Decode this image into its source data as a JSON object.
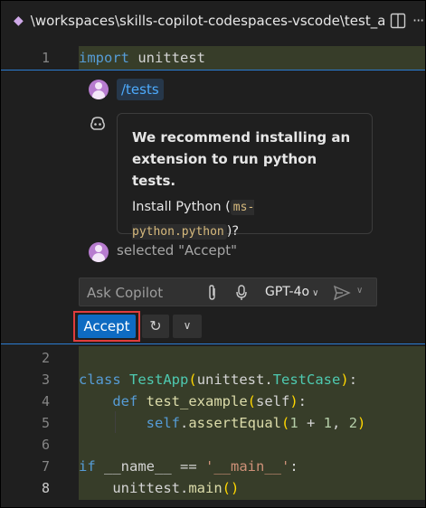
{
  "tab": {
    "file_icon": "file-icon",
    "path": "\\workspaces\\skills-copilot-codespaces-vscode\\test_ap"
  },
  "toolbar": {
    "split_icon": "split-editor-icon",
    "more_icon": "more-actions-icon",
    "more_glyph": "···"
  },
  "code_lines": [
    {
      "num": "1"
    },
    {
      "num": "2"
    },
    {
      "num": "3"
    },
    {
      "num": "4"
    },
    {
      "num": "5"
    },
    {
      "num": "6"
    },
    {
      "num": "7"
    },
    {
      "num": "8"
    }
  ],
  "code": {
    "line1_kw": "import",
    "line1_rest": " unittest",
    "line3_kw": "class",
    "line3_cls": "TestApp",
    "line3_mid": "unittest.",
    "line3_base": "TestCase",
    "line3_end": ":",
    "line4_kw": "def",
    "line4_fn": "test_example",
    "line4_param": "self",
    "line4_end": ":",
    "line5_self": "self",
    "line5_dot": ".",
    "line5_fn": "assertEqual",
    "line5_n1": "1",
    "line5_plus": " + ",
    "line5_n2": "1",
    "line5_comma": ", ",
    "line5_n3": "2",
    "line7_kw": "if",
    "line7_mid": " __name__ == ",
    "line7_str": "'__main__'",
    "line7_end": ":",
    "line8_text": "unittest.",
    "line8_fn": "main"
  },
  "chat": {
    "user_avatar": "user-avatar",
    "slash_command": "/tests",
    "copilot_icon": "copilot-icon",
    "message_title": "We recommend installing an extension to run python tests.",
    "message_body_prefix": "Install Python (",
    "message_code": "ms-python.python",
    "message_body_suffix": ")?",
    "selected_text": "selected \"Accept\""
  },
  "input": {
    "placeholder": "Ask Copilot",
    "attach_icon": "paperclip-icon",
    "mic_icon": "microphone-icon",
    "model": "GPT-4o",
    "send_icon": "send-icon"
  },
  "actions": {
    "accept_label": "Accept",
    "rerun_icon": "rerun-icon",
    "menu_icon": "chevron-down-icon"
  },
  "colors": {
    "accent": "#0e6bc2",
    "highlight_border": "#e03c3c",
    "diff_bg": "#373d29",
    "editor_bg": "#1f1f1f"
  }
}
